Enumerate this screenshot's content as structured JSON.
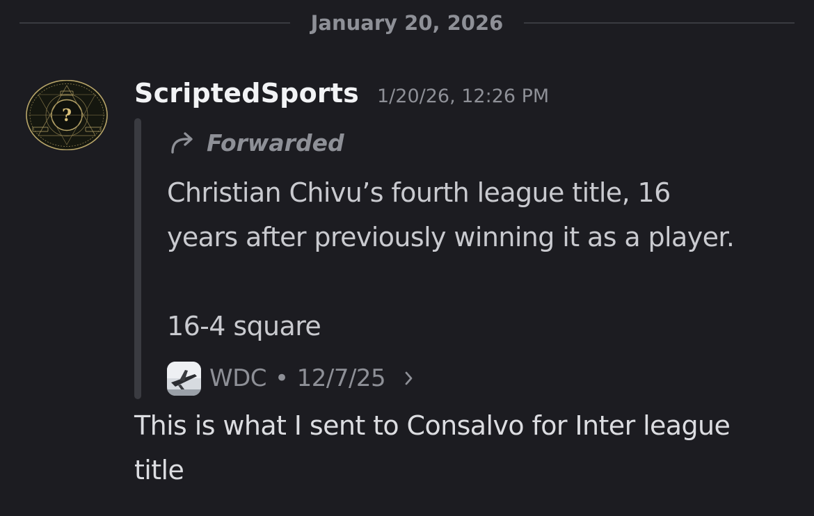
{
  "date_divider": {
    "text": "January 20, 2026"
  },
  "message": {
    "author": "ScriptedSports",
    "timestamp": "1/20/26, 12:26 PM",
    "avatar_icon": "mystery-question-emblem-icon",
    "forwarded": {
      "label": "Forwarded",
      "icon": "forward-arrow-icon",
      "lines": [
        "Christian Chivu’s fourth league title, 16",
        "years after previously winning it as a player.",
        "",
        "16-4 square"
      ],
      "source": {
        "name": "WDC",
        "separator": "•",
        "date": "12/7/25",
        "icon": "chevron-right-icon",
        "avatar_icon": "server-thumbnail-icon"
      }
    },
    "content_lines": [
      "This is what I sent to Consalvo for Inter league",
      "title"
    ]
  },
  "colors": {
    "background": "#1c1c21",
    "muted_text": "#8e9097",
    "author": "#f2f3f5",
    "quote_bar": "#3a3b41",
    "avatar_gold": "#b9a66a"
  }
}
